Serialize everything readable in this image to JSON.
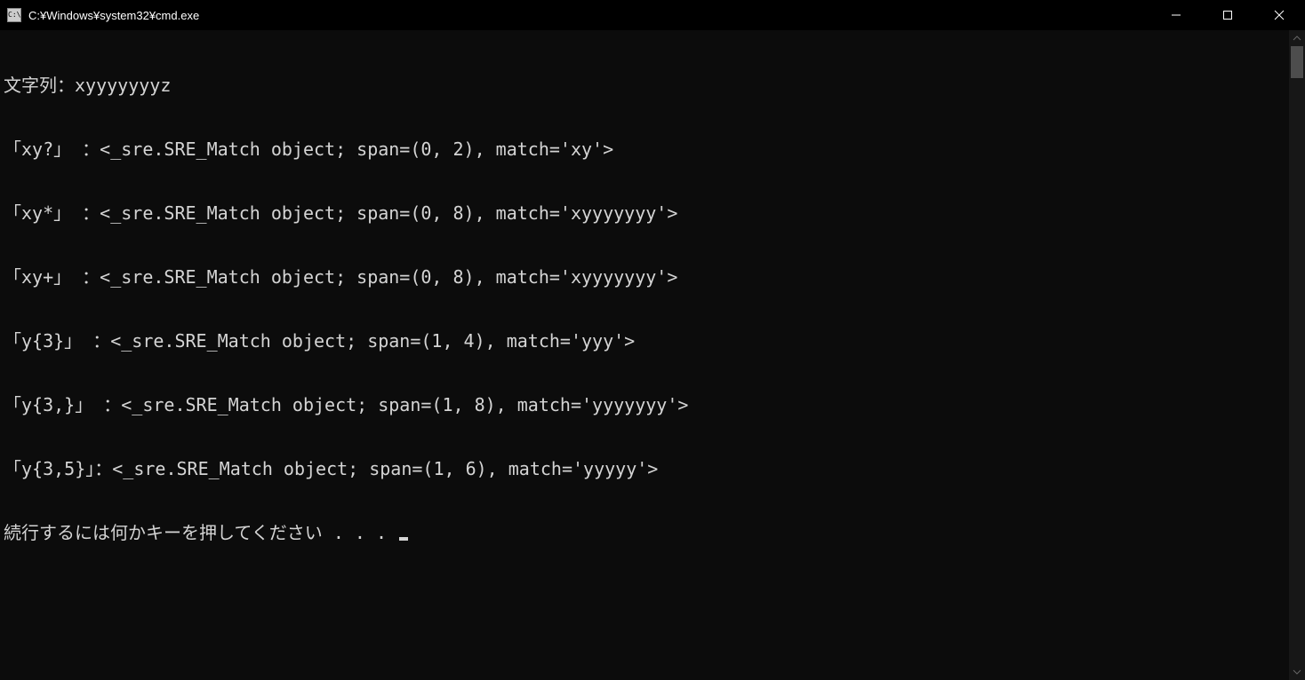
{
  "titlebar": {
    "icon_label": "C:\\",
    "title": "C:¥Windows¥system32¥cmd.exe"
  },
  "terminal": {
    "lines": [
      "文字列：xyyyyyyyz",
      "「xy?」 ：<_sre.SRE_Match object; span=(0, 2), match='xy'>",
      "「xy*」 ：<_sre.SRE_Match object; span=(0, 8), match='xyyyyyyy'>",
      "「xy+」 ：<_sre.SRE_Match object; span=(0, 8), match='xyyyyyyy'>",
      "「y{3}」 ：<_sre.SRE_Match object; span=(1, 4), match='yyy'>",
      "「y{3,}」 ：<_sre.SRE_Match object; span=(1, 8), match='yyyyyyy'>",
      "「y{3,5}」：<_sre.SRE_Match object; span=(1, 6), match='yyyyy'>"
    ],
    "prompt_line": "続行するには何かキーを押してください . . . "
  }
}
